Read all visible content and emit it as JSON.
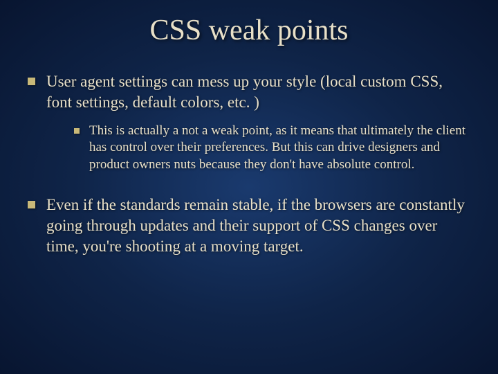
{
  "title": "CSS weak points",
  "bullets": [
    {
      "text": "User agent settings can mess up your style (local custom CSS, font settings, default colors, etc. )",
      "children": [
        {
          "text": "This is actually a not a weak point, as it means that ultimately the client has control over their preferences.  But this can drive designers and product owners nuts because they don't have absolute control."
        }
      ]
    },
    {
      "text": "Even if the standards remain stable, if the browsers are constantly going through updates and their support of CSS changes over time, you're shooting at a moving target."
    }
  ]
}
